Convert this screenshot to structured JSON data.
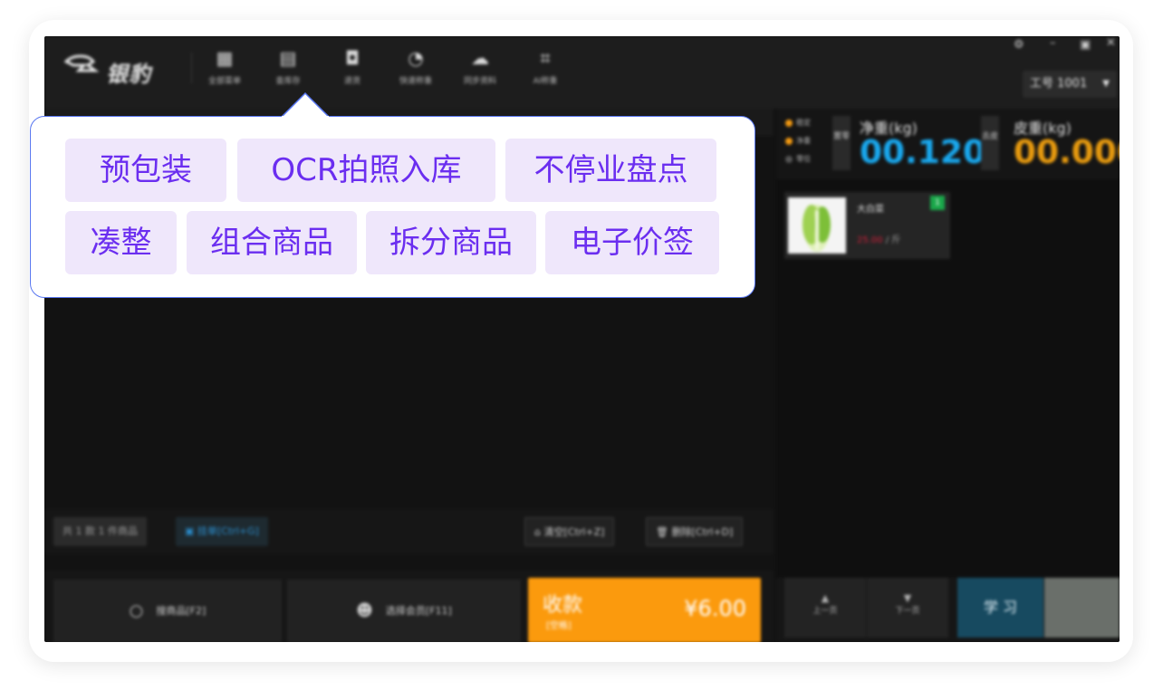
{
  "app": {
    "logo_text": "银豹",
    "nav": [
      {
        "label": "全部菜单",
        "icon": "grid-icon"
      },
      {
        "label": "查库存",
        "icon": "inventory-icon"
      },
      {
        "label": "退货",
        "icon": "return-icon"
      },
      {
        "label": "快速称重",
        "icon": "scale-icon"
      },
      {
        "label": "同步资料",
        "icon": "cloud-sync-icon"
      },
      {
        "label": "AI称重",
        "icon": "ai-scan-icon"
      }
    ],
    "worker": "工号 1001",
    "status": {
      "count": "共 1 款 1 件商品",
      "hold": "挂单[Ctrl+G]",
      "clear": "清空[Ctrl+Z]",
      "delete": "删除[Ctrl+D]"
    },
    "bottom": {
      "search": "搜商品[F2]",
      "member": "选择会员[F11]",
      "pay_label": "收款",
      "pay_sub": "[空格]",
      "pay_amount": "¥6.00"
    },
    "scale": {
      "legend": [
        "稳定",
        "净重",
        "零位"
      ],
      "zero_btn": "置零",
      "tare_btn": "去皮",
      "net_label": "净重(kg)",
      "net_value": "00.120",
      "tare_label": "皮重(kg)",
      "tare_value": "00.000"
    },
    "product": {
      "name": "大白菜",
      "price": "25.00",
      "unit": " / 斤",
      "badge": "1"
    },
    "right_bottom": {
      "prev": "上一页",
      "next": "下一页",
      "learn": "学 习"
    }
  },
  "popup": {
    "row1": [
      "预包装",
      "OCR拍照入库",
      "不停业盘点"
    ],
    "row2": [
      "凑整",
      "组合商品",
      "拆分商品",
      "电子价签"
    ]
  }
}
